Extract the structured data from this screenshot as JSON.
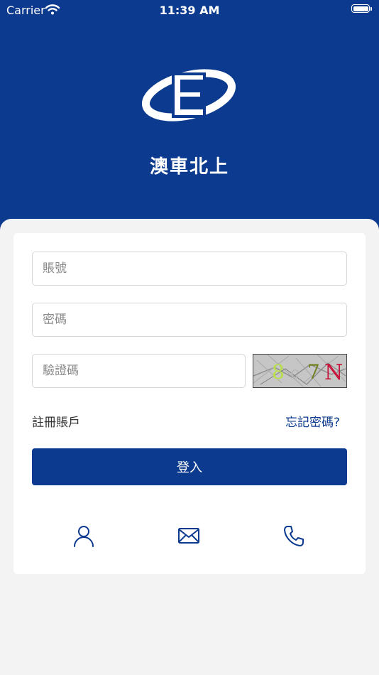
{
  "status_bar": {
    "carrier": "Carrier",
    "time": "11:39 AM",
    "wifi_icon": "wifi-icon",
    "battery_icon": "battery-icon"
  },
  "header": {
    "logo_icon": "brand-logo-icon",
    "title": "澳車北上",
    "background_color": "#0b3a8e"
  },
  "form": {
    "account_placeholder": "賬號",
    "password_placeholder": "密碼",
    "captcha_placeholder": "驗證碼",
    "captcha_text": "8c7N",
    "register_label": "註冊賬戶",
    "forgot_label": "忘記密碼?",
    "login_label": "登入"
  },
  "footer_icons": [
    "person-icon",
    "mail-icon",
    "phone-icon"
  ],
  "colors": {
    "primary": "#0b3a8e",
    "page_background": "#f3f3f3",
    "card_background": "#ffffff"
  }
}
